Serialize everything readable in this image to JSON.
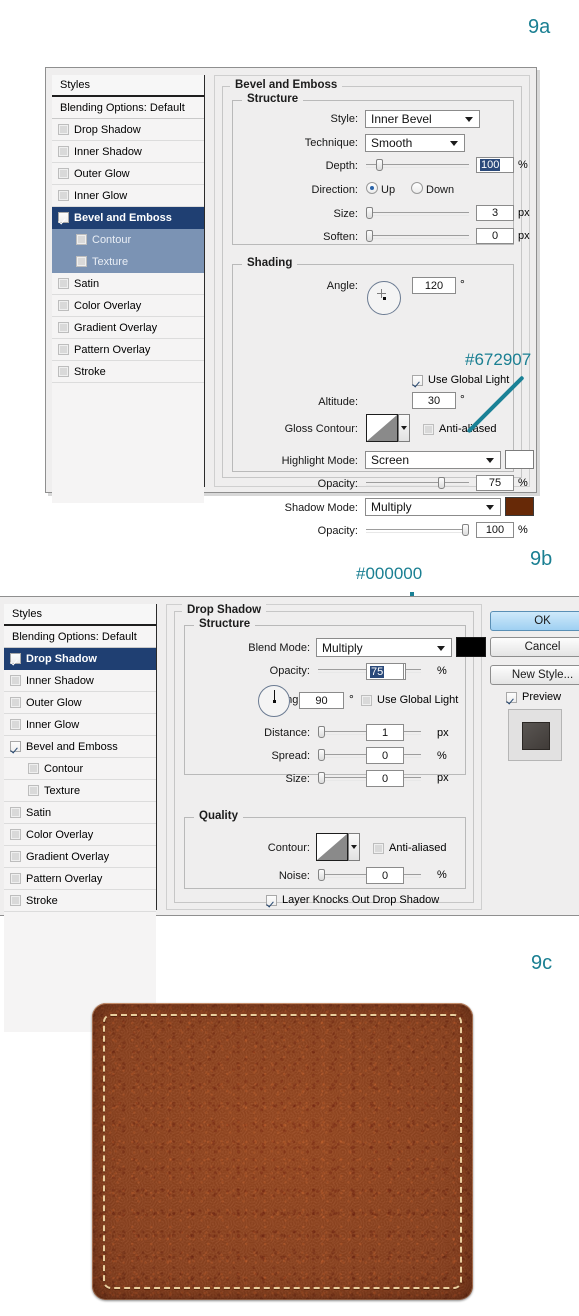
{
  "figures": {
    "a": "9a",
    "b": "9b",
    "c": "9c"
  },
  "styles_panel": {
    "header": "Styles",
    "blending_options": "Blending Options: Default",
    "items_a": [
      {
        "label": "Drop Shadow",
        "checked": false,
        "selected": false,
        "sub": false
      },
      {
        "label": "Inner Shadow",
        "checked": false,
        "selected": false,
        "sub": false
      },
      {
        "label": "Outer Glow",
        "checked": false,
        "selected": false,
        "sub": false
      },
      {
        "label": "Inner Glow",
        "checked": false,
        "selected": false,
        "sub": false
      },
      {
        "label": "Bevel and Emboss",
        "checked": true,
        "selected": true,
        "sub": false
      },
      {
        "label": "Contour",
        "checked": false,
        "selected": false,
        "sub": true,
        "subhl": true
      },
      {
        "label": "Texture",
        "checked": false,
        "selected": false,
        "sub": true,
        "subhl": true
      },
      {
        "label": "Satin",
        "checked": false,
        "selected": false,
        "sub": false
      },
      {
        "label": "Color Overlay",
        "checked": false,
        "selected": false,
        "sub": false
      },
      {
        "label": "Gradient Overlay",
        "checked": false,
        "selected": false,
        "sub": false
      },
      {
        "label": "Pattern Overlay",
        "checked": false,
        "selected": false,
        "sub": false
      },
      {
        "label": "Stroke",
        "checked": false,
        "selected": false,
        "sub": false
      }
    ],
    "items_b": [
      {
        "label": "Drop Shadow",
        "checked": true,
        "selected": true,
        "sub": false
      },
      {
        "label": "Inner Shadow",
        "checked": false,
        "selected": false,
        "sub": false
      },
      {
        "label": "Outer Glow",
        "checked": false,
        "selected": false,
        "sub": false
      },
      {
        "label": "Inner Glow",
        "checked": false,
        "selected": false,
        "sub": false
      },
      {
        "label": "Bevel and Emboss",
        "checked": true,
        "selected": false,
        "sub": false
      },
      {
        "label": "Contour",
        "checked": false,
        "selected": false,
        "sub": true,
        "subhl": false
      },
      {
        "label": "Texture",
        "checked": false,
        "selected": false,
        "sub": true,
        "subhl": false
      },
      {
        "label": "Satin",
        "checked": false,
        "selected": false,
        "sub": false
      },
      {
        "label": "Color Overlay",
        "checked": false,
        "selected": false,
        "sub": false
      },
      {
        "label": "Gradient Overlay",
        "checked": false,
        "selected": false,
        "sub": false
      },
      {
        "label": "Pattern Overlay",
        "checked": false,
        "selected": false,
        "sub": false
      },
      {
        "label": "Stroke",
        "checked": false,
        "selected": false,
        "sub": false
      }
    ]
  },
  "bevel_panel": {
    "title": "Bevel and Emboss",
    "structure": {
      "title": "Structure",
      "style_label": "Style:",
      "style_value": "Inner Bevel",
      "technique_label": "Technique:",
      "technique_value": "Smooth",
      "depth_label": "Depth:",
      "depth_value": "100",
      "depth_unit": "%",
      "direction_label": "Direction:",
      "direction_up": "Up",
      "direction_down": "Down",
      "direction_selected": "Up",
      "size_label": "Size:",
      "size_value": "3",
      "size_unit": "px",
      "soften_label": "Soften:",
      "soften_value": "0",
      "soften_unit": "px"
    },
    "shading": {
      "title": "Shading",
      "angle_label": "Angle:",
      "angle_value": "120",
      "angle_unit": "°",
      "use_global_light": "Use Global Light",
      "use_global_light_checked": true,
      "altitude_label": "Altitude:",
      "altitude_value": "30",
      "altitude_unit": "°",
      "gloss_contour_label": "Gloss Contour:",
      "anti_aliased": "Anti-aliased",
      "anti_aliased_checked": false,
      "highlight_mode_label": "Highlight Mode:",
      "highlight_mode_value": "Screen",
      "highlight_color": "#ffffff",
      "highlight_opacity_label": "Opacity:",
      "highlight_opacity_value": "75",
      "highlight_opacity_unit": "%",
      "shadow_mode_label": "Shadow Mode:",
      "shadow_mode_value": "Multiply",
      "shadow_color": "#672907",
      "shadow_opacity_label": "Opacity:",
      "shadow_opacity_value": "100",
      "shadow_opacity_unit": "%"
    },
    "annotation": {
      "text": "#672907"
    }
  },
  "dropshadow_panel": {
    "title": "Drop Shadow",
    "structure": {
      "title": "Structure",
      "blend_mode_label": "Blend Mode:",
      "blend_mode_value": "Multiply",
      "color": "#000000",
      "opacity_label": "Opacity:",
      "opacity_value": "75",
      "opacity_unit": "%",
      "angle_label": "Angle:",
      "angle_value": "90",
      "angle_unit": "°",
      "use_global_light": "Use Global Light",
      "use_global_light_checked": false,
      "distance_label": "Distance:",
      "distance_value": "1",
      "distance_unit": "px",
      "spread_label": "Spread:",
      "spread_value": "0",
      "spread_unit": "%",
      "size_label": "Size:",
      "size_value": "0",
      "size_unit": "px"
    },
    "quality": {
      "title": "Quality",
      "contour_label": "Contour:",
      "anti_aliased": "Anti-aliased",
      "anti_aliased_checked": false,
      "noise_label": "Noise:",
      "noise_value": "0",
      "noise_unit": "%",
      "knockout_label": "Layer Knocks Out Drop Shadow",
      "knockout_checked": true
    },
    "buttons": {
      "ok": "OK",
      "cancel": "Cancel",
      "new_style": "New Style...",
      "preview": "Preview",
      "preview_checked": true
    },
    "annotation": {
      "text": "#000000"
    }
  },
  "leather": {
    "base_color": "#8c4320",
    "stitch_color": "#e9cf9e"
  }
}
